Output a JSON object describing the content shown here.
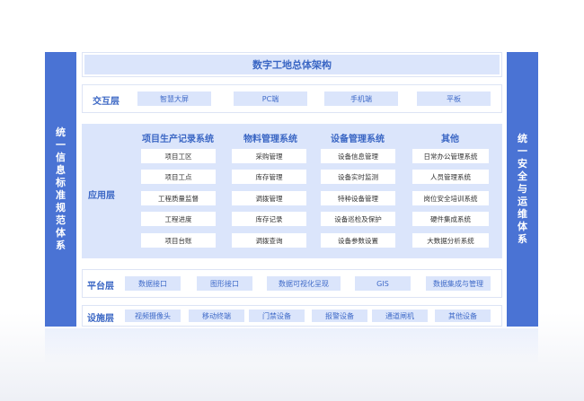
{
  "title": "数字工地总体架构",
  "left_side": "统一信息标准规范体系",
  "right_side": "统一安全与运维体系",
  "interaction": {
    "label": "交互层",
    "items": [
      "智慧大屏",
      "PC端",
      "手机端",
      "平板"
    ]
  },
  "application": {
    "label": "应用层",
    "columns": [
      {
        "title": "项目生产记录系统",
        "items": [
          "项目工区",
          "项目工点",
          "工程质量监督",
          "工程进度",
          "项目台账"
        ]
      },
      {
        "title": "物料管理系统",
        "items": [
          "采购管理",
          "库存管理",
          "调拨管理",
          "库存记录",
          "调拨查询"
        ]
      },
      {
        "title": "设备管理系统",
        "items": [
          "设备信息管理",
          "设备实时监测",
          "特种设备管理",
          "设备巡检及保护",
          "设备参数设置"
        ]
      },
      {
        "title": "其他",
        "items": [
          "日常办公管理系统",
          "人员管理系统",
          "岗位安全培训系统",
          "硬件集成系统",
          "大数据分析系统"
        ]
      }
    ]
  },
  "platform": {
    "label": "平台层",
    "items": [
      "数据接口",
      "图形接口",
      "数据可视化呈现",
      "GIS",
      "数据集成与管理"
    ]
  },
  "infrastructure": {
    "label": "设施层",
    "items": [
      "视频摄像头",
      "移动终端",
      "门禁设备",
      "报警设备",
      "通道闸机",
      "其他设备"
    ]
  }
}
